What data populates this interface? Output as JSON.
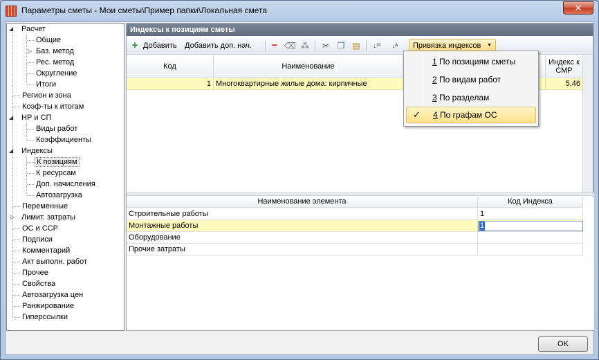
{
  "window": {
    "title": "Параметры сметы - Мои сметы\\Пример папки\\Локальная смета",
    "close_label": "✕"
  },
  "tree": [
    {
      "label": "Расчет",
      "expander": "◢"
    },
    {
      "label": "Общие"
    },
    {
      "label": "Баз. метод",
      "expander": "▷"
    },
    {
      "label": "Рес. метод"
    },
    {
      "label": "Округление"
    },
    {
      "label": "Итоги"
    },
    {
      "label": "Регион и зона"
    },
    {
      "label": "Коэф-ты к итогам"
    },
    {
      "label": "НР и СП",
      "expander": "◢"
    },
    {
      "label": "Виды работ"
    },
    {
      "label": "Коэффициенты"
    },
    {
      "label": "Индексы",
      "expander": "◢"
    },
    {
      "label": "К позициям"
    },
    {
      "label": "К ресурсам"
    },
    {
      "label": "Доп. начисления"
    },
    {
      "label": "Автозагрузка"
    },
    {
      "label": "Переменные"
    },
    {
      "label": "Лимит. затраты",
      "expander": "▷"
    },
    {
      "label": "ОС и ССР"
    },
    {
      "label": "Подписи"
    },
    {
      "label": "Комментарий"
    },
    {
      "label": "Акт выполн. работ"
    },
    {
      "label": "Прочее"
    },
    {
      "label": "Свойства"
    },
    {
      "label": "Автозагрузка цен"
    },
    {
      "label": "Ранжирование"
    },
    {
      "label": "Гиперссылки"
    }
  ],
  "panel": {
    "title": "Индексы к позициям сметы",
    "toolbar": {
      "add": "Добавить",
      "add_extra": "Добавить доп. нач.",
      "binding": "Привязка индексов"
    },
    "upper_grid": {
      "headers": [
        "Код",
        "Наименование",
        "",
        "Индекс к СМР"
      ],
      "row": {
        "code": "1",
        "name": "Многоквартирные жилые дома: кирпичные",
        "index": "5,46"
      }
    },
    "lower_grid": {
      "headers": [
        "Наименование элемента",
        "Код Индекса"
      ],
      "rows": [
        {
          "name": "Строительные работы",
          "code": "1"
        },
        {
          "name": "Монтажные работы",
          "code": "1"
        },
        {
          "name": "Оборудование",
          "code": ""
        },
        {
          "name": "Прочие затраты",
          "code": ""
        }
      ]
    }
  },
  "menu": [
    {
      "num": "1",
      "text": " По позициям сметы"
    },
    {
      "num": "2",
      "text": " По видам работ"
    },
    {
      "num": "3",
      "text": " По разделам"
    },
    {
      "num": "4",
      "text": " По графам ОС",
      "checked": "✓"
    }
  ],
  "ok_label": "OK",
  "colors": {
    "selection": "#fffbbf",
    "panel_header": "#5e6b7d",
    "accent": "#ffd97a"
  }
}
